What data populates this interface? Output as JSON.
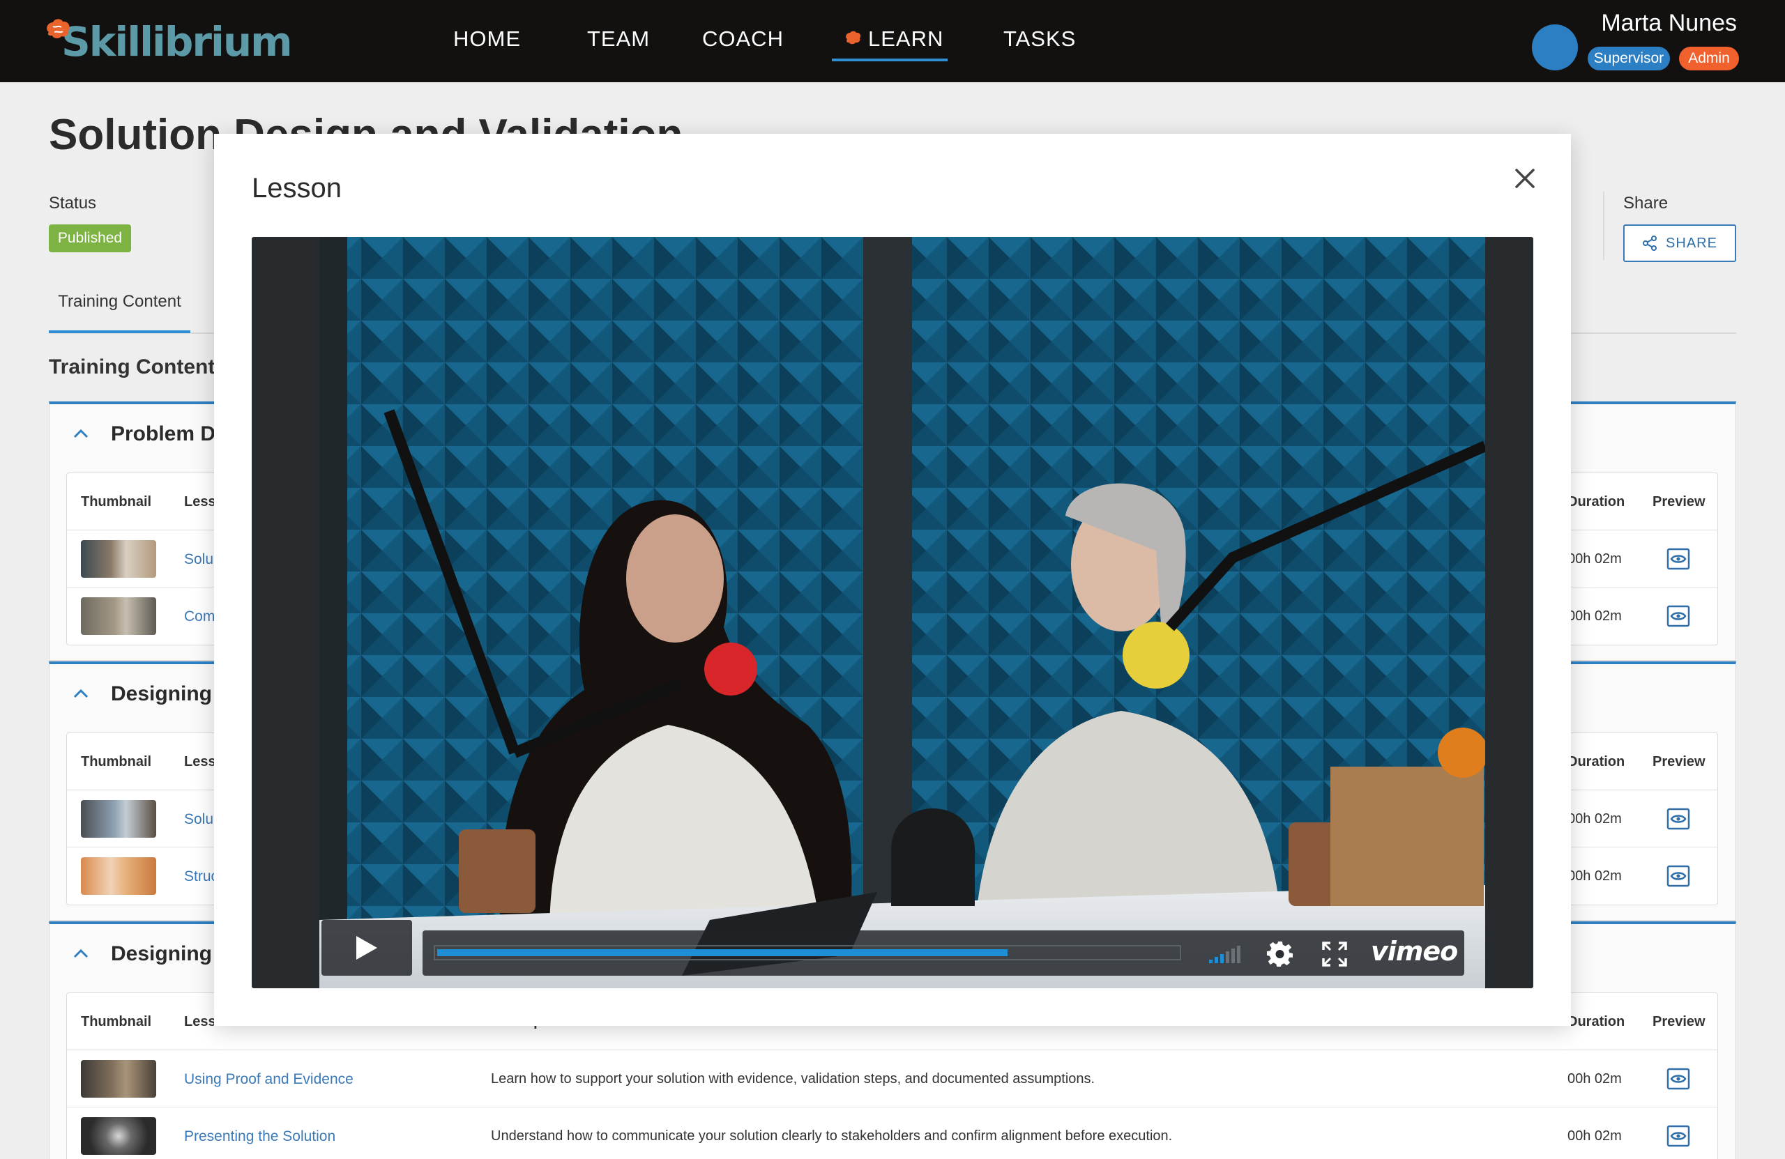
{
  "brand": {
    "name": "Skillibrium",
    "logo_color": "#5c9aa8"
  },
  "nav": {
    "items": [
      {
        "label": "HOME"
      },
      {
        "label": "TEAM"
      },
      {
        "label": "COACH"
      },
      {
        "label": "LEARN",
        "active": true,
        "icon": "brain-icon"
      },
      {
        "label": "TASKS"
      }
    ],
    "accent": "#2f8fd4"
  },
  "user": {
    "name": "Marta Nunes",
    "roles": [
      "Supervisor",
      "Admin"
    ],
    "role_colors": [
      "#2d7fc4",
      "#f0612e"
    ]
  },
  "page": {
    "title": "Solution Design and Validation",
    "status_label": "Status",
    "status_value": "Published",
    "status_color": "#7cb342",
    "share_label": "Share",
    "share_button": "SHARE",
    "tabs": [
      {
        "label": "Training Content",
        "active": true
      }
    ],
    "section_heading": "Training Content"
  },
  "table_headers": {
    "thumbnail": "Thumbnail",
    "lesson": "Lesson",
    "description": "Description",
    "duration": "Duration",
    "preview": "Preview"
  },
  "modules": [
    {
      "title": "Problem De",
      "lessons": [
        {
          "lesson": "Solu",
          "description": "",
          "duration": "00h 02m"
        },
        {
          "lesson": "Com",
          "description": "",
          "duration": "00h 02m"
        }
      ]
    },
    {
      "title": "Designing A",
      "lessons": [
        {
          "lesson": "Solu",
          "description": "",
          "duration": "00h 02m"
        },
        {
          "lesson": "Struc",
          "description": "",
          "duration": "00h 02m"
        }
      ]
    },
    {
      "title": "Designing A",
      "lessons": [
        {
          "lesson": "Using Proof and Evidence",
          "description": "Learn how to support your solution with evidence, validation steps, and documented assumptions.",
          "duration": "00h 02m"
        },
        {
          "lesson": "Presenting the Solution",
          "description": "Understand how to communicate your solution clearly to stakeholders and confirm alignment before execution.",
          "duration": "00h 02m"
        }
      ]
    }
  ],
  "modal": {
    "title": "Lesson",
    "close_icon": "close-icon",
    "player": {
      "brand": "vimeo",
      "progress": 0.77,
      "progress_color": "#1e8fd6",
      "controls": [
        "play-icon",
        "volume-icon",
        "gear-icon",
        "fullscreen-icon"
      ]
    }
  }
}
